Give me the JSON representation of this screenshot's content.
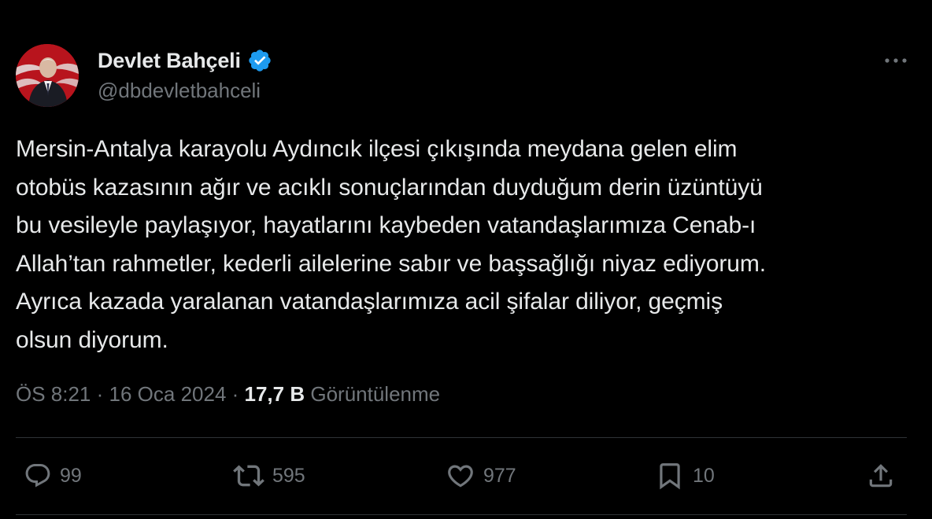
{
  "user": {
    "display_name": "Devlet Bahçeli",
    "handle": "@dbdevletbahceli",
    "verified": true
  },
  "tweet": {
    "text": "Mersin-Antalya karayolu Aydıncık ilçesi çıkışında meydana gelen elim\notobüs kazasının ağır ve acıklı sonuçlarından duyduğum derin üzüntüyü\nbu vesileyle paylaşıyor, hayatlarını kaybeden vatandaşlarımıza Cenab-ı\nAllah’tan rahmetler, kederli ailelerine sabır ve başsağlığı niyaz ediyorum.\nAyrıca kazada yaralanan vatandaşlarımıza acil şifalar diliyor, geçmiş\nolsun diyorum.",
    "time": "ÖS 8:21",
    "date": "16 Oca 2024",
    "separator": " · ",
    "views_count": "17,7 B",
    "views_label": "Görüntülenme"
  },
  "actions": {
    "replies": "99",
    "reposts": "595",
    "likes": "977",
    "bookmarks": "10"
  },
  "icons": {
    "more": "more-horizontal-icon",
    "verified": "verified-badge-icon",
    "reply": "reply-bubble-icon",
    "repost": "repost-icon",
    "like": "heart-icon",
    "bookmark": "bookmark-icon",
    "share": "share-icon"
  },
  "colors": {
    "background": "#000000",
    "text_primary": "#e7e9ea",
    "text_secondary": "#71767b",
    "verified_blue": "#1d9bf0",
    "divider": "#2f3336"
  }
}
